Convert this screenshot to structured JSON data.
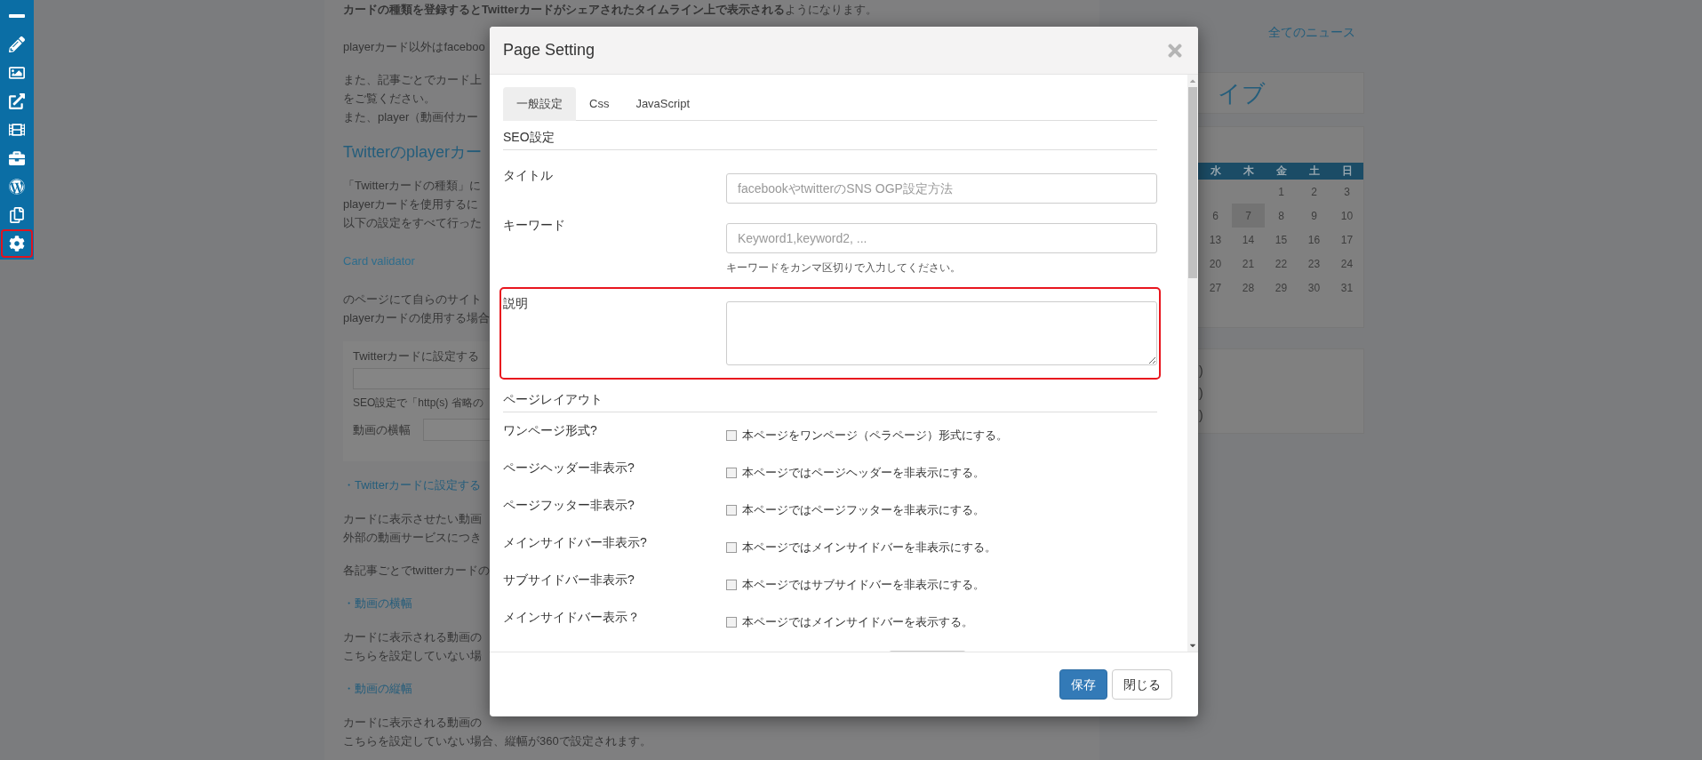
{
  "sidebar": {
    "items": [
      {
        "kind": "minus",
        "highlighted": false
      },
      {
        "kind": "pencil",
        "highlighted": false
      },
      {
        "kind": "image",
        "highlighted": false
      },
      {
        "kind": "external",
        "highlighted": false
      },
      {
        "kind": "film",
        "highlighted": false
      },
      {
        "kind": "briefcase",
        "highlighted": false
      },
      {
        "kind": "wordpress",
        "highlighted": false
      },
      {
        "kind": "copy",
        "highlighted": false
      },
      {
        "kind": "gear",
        "highlighted": true
      }
    ]
  },
  "article": {
    "blocks": [
      {
        "kind": "paragraph",
        "lines": [
          "**カードの種類を登録するとTwitterカードがシェアされたタイムライン上で表示される**ようになります。"
        ]
      },
      {
        "kind": "paragraph",
        "lines": [
          "playerカード以外はfaceboo"
        ]
      },
      {
        "kind": "paragraph",
        "lines": [
          "また、記事ごとでカード上",
          "をご覧ください。",
          "また、player（動画付カー"
        ]
      },
      {
        "kind": "heading",
        "text": "Twitterのplayerカー"
      },
      {
        "kind": "paragraph",
        "lines": [
          "「Twitterカードの種類」に",
          "playerカードを使用するに",
          "以下の設定をすべて行った"
        ]
      },
      {
        "kind": "link",
        "text": "Card validator"
      },
      {
        "kind": "paragraph",
        "lines": [
          "のページにて自らのサイト",
          "playerカードの使用する場合"
        ]
      },
      {
        "kind": "form_box",
        "title": "Twitterカードに設定する",
        "note": "SEO設定で「http(s) 省略の",
        "field_label": "動画の横幅"
      },
      {
        "kind": "bullet",
        "text": "・Twitterカードに設定する"
      },
      {
        "kind": "paragraph",
        "lines": [
          "カードに表示させたい動画",
          "外部の動画サービスにつき"
        ]
      },
      {
        "kind": "paragraph",
        "lines": [
          "各記事ごとでtwitterカードの"
        ]
      },
      {
        "kind": "bullet",
        "text": "・動画の横幅"
      },
      {
        "kind": "paragraph",
        "lines": [
          "カードに表示される動画の",
          "こちらを設定していない場"
        ]
      },
      {
        "kind": "bullet",
        "text": "・動画の縦幅"
      },
      {
        "kind": "paragraph",
        "lines": [
          "カードに表示される動画の",
          "こちらを設定していない場合、縦幅が360で設定されます。"
        ]
      }
    ]
  },
  "news_link": "全てのニュース",
  "archive_widget": {
    "title": "イブ"
  },
  "calendar": {
    "weekdays": [
      "水",
      "木",
      "金",
      "土",
      "日"
    ],
    "weeks": [
      [
        {
          "kind": "blank"
        },
        {
          "kind": "blank"
        },
        {
          "kind": "day",
          "day": "1",
          "selected": false
        },
        {
          "kind": "day",
          "day": "2",
          "selected": false
        },
        {
          "kind": "day",
          "day": "3",
          "selected": false
        }
      ],
      [
        {
          "kind": "day",
          "day": "6",
          "selected": false
        },
        {
          "kind": "day",
          "day": "7",
          "selected": true
        },
        {
          "kind": "day",
          "day": "8",
          "selected": false
        },
        {
          "kind": "day",
          "day": "9",
          "selected": false
        },
        {
          "kind": "day",
          "day": "10",
          "selected": false
        }
      ],
      [
        {
          "kind": "day",
          "day": "13",
          "selected": false
        },
        {
          "kind": "day",
          "day": "14",
          "selected": false
        },
        {
          "kind": "day",
          "day": "15",
          "selected": false
        },
        {
          "kind": "day",
          "day": "16",
          "selected": false
        },
        {
          "kind": "day",
          "day": "17",
          "selected": false
        }
      ],
      [
        {
          "kind": "day",
          "day": "20",
          "selected": false
        },
        {
          "kind": "day",
          "day": "21",
          "selected": false
        },
        {
          "kind": "day",
          "day": "22",
          "selected": false
        },
        {
          "kind": "day",
          "day": "23",
          "selected": false
        },
        {
          "kind": "day",
          "day": "24",
          "selected": false
        }
      ],
      [
        {
          "kind": "day",
          "day": "27",
          "selected": false
        },
        {
          "kind": "day",
          "day": "28",
          "selected": false
        },
        {
          "kind": "day",
          "day": "29",
          "selected": false
        },
        {
          "kind": "day",
          "day": "30",
          "selected": false
        },
        {
          "kind": "day",
          "day": "31",
          "selected": false
        }
      ]
    ]
  },
  "list_widget": {
    "lines": [
      ")",
      ")",
      ")"
    ]
  },
  "modal": {
    "title": "Page Setting",
    "tabs": [
      {
        "label": "一般設定",
        "selected": true
      },
      {
        "label": "Css",
        "selected": false
      },
      {
        "label": "JavaScript",
        "selected": false
      }
    ],
    "sections": [
      {
        "title": "SEO設定",
        "fields": [
          {
            "kind": "text",
            "label": "タイトル",
            "placeholder": "facebookやtwitterのSNS OGP設定方法",
            "highlighted": false
          },
          {
            "kind": "text",
            "label": "キーワード",
            "placeholder": "Keyword1,keyword2, ...",
            "help": "キーワードをカンマ区切りで入力してください。",
            "highlighted": false
          },
          {
            "kind": "textarea",
            "label": "説明",
            "highlighted": true
          }
        ]
      },
      {
        "title": "ページレイアウト",
        "fields": [
          {
            "kind": "checkbox",
            "label": "ワンページ形式?",
            "option": "本ページをワンページ（ペラページ）形式にする。",
            "checked": false
          },
          {
            "kind": "checkbox",
            "label": "ページヘッダー非表示?",
            "option": "本ページではページヘッダーを非表示にする。",
            "checked": false
          },
          {
            "kind": "checkbox",
            "label": "ページフッター非表示?",
            "option": "本ページではページフッターを非表示にする。",
            "checked": false
          },
          {
            "kind": "checkbox",
            "label": "メインサイドバー非表示?",
            "option": "本ページではメインサイドバーを非表示にする。",
            "checked": false
          },
          {
            "kind": "checkbox",
            "label": "サブサイドバー非表示?",
            "option": "本ページではサブサイドバーを非表示にする。",
            "checked": false
          },
          {
            "kind": "checkbox",
            "label": "メインサイドバー表示？",
            "option": "本ページではメインサイドバーを表示する。",
            "checked": false
          },
          {
            "kind": "partial_input"
          }
        ]
      }
    ],
    "buttons": [
      {
        "label": "保存",
        "kind": "primary"
      },
      {
        "label": "閉じる",
        "kind": "default"
      }
    ]
  }
}
